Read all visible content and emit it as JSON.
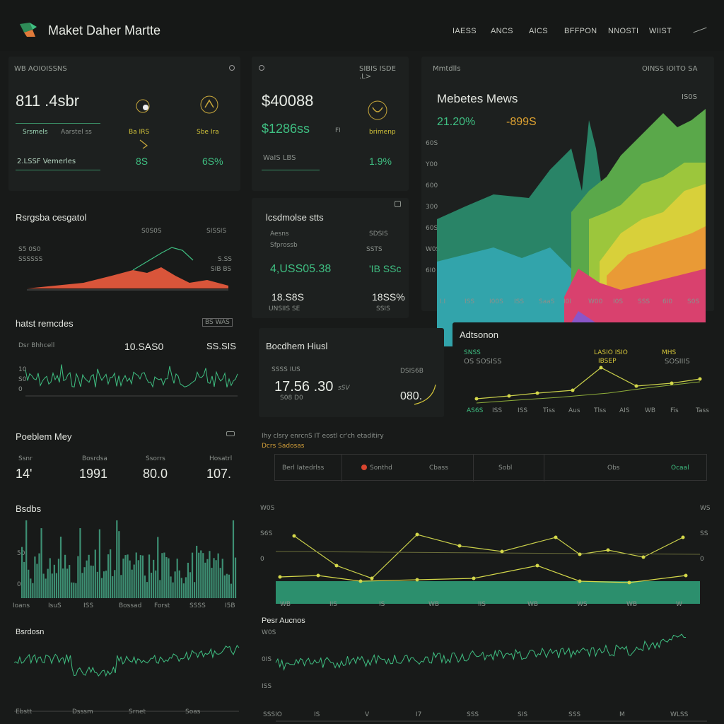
{
  "header": {
    "title": "Maket Daher Martte",
    "nav": [
      "IAESS",
      "ANCS",
      "AICS",
      "BFFPON",
      "NNOSTI",
      "WIIST"
    ],
    "logo_colors": [
      "#2e8b57",
      "#e07a3a",
      "#3fbf82"
    ]
  },
  "panel1": {
    "title": "WB AOIOISSNS",
    "big_value": "811 .4sbr",
    "sub_left": "Srsmels",
    "sub_right": "Aarstel ss",
    "bottom_left": "2.LSSF Vemerles",
    "col2_label": "Ba IRS",
    "col2_value": "8S",
    "col3_label": "Sbe Ira",
    "col3_value": "6S%"
  },
  "panel2": {
    "title": "SIBIS ISDE .L>",
    "big_value": "$40088",
    "green_value": "$1286ss",
    "green_suffix": "FI",
    "label_a": "WaIS LBS",
    "label_b": "brimenp",
    "pct": "1.9%"
  },
  "panel3": {
    "title": "Mmtdlls",
    "right_label": "OINSS IOITO SA",
    "heading": "Mebetes Mews",
    "tag": "IS0S",
    "green_pct": "21.20%",
    "orange_pct": "-899S",
    "y_ticks": [
      "60S",
      "Y00",
      "600",
      "300",
      "60S",
      "W0S",
      "6I0"
    ],
    "x_ticks": [
      "I.I",
      "ISS",
      "I00S",
      "ISS",
      "SaaS",
      "I0I",
      "W00",
      "I0S",
      "SSS",
      "6I0",
      "S0S"
    ]
  },
  "panel4": {
    "title": "Rsrgsba cesgatol",
    "tick_a": "S0S0S",
    "tick_b": "SISSIS",
    "y_a": "S5 0S0",
    "y_b": "SSSSSS",
    "legend": "S.SS",
    "legend2": "SIB BS"
  },
  "panel5": {
    "title": "lcsdmolse stts",
    "label_a": "Aesns",
    "label_b": "Sfprossb",
    "label_c": "SDSIS",
    "label_d": "SSTS",
    "green_value": "4,USS05.38",
    "green_value_b": "'IB SSc",
    "val_a": "18.S8S",
    "val_b": "18SS%",
    "sub_a": "UNSIIS SE",
    "sub_b": "SSIS"
  },
  "panel6": {
    "title": "hatst remcdes",
    "corner": "BS WAS",
    "label": "Dsr Bhhcell",
    "value_a": "10.SAS0",
    "value_b": "SS.SIS",
    "y_ticks": [
      "10",
      "S0",
      "0"
    ]
  },
  "panel7": {
    "title": "Bocdhem Hiusl",
    "label_a": "SSSS IUS",
    "label_b": "DSIS6B",
    "value": "17.56 .30",
    "value_suffix": "sSV",
    "sub": "S08 D0",
    "right_value": "080."
  },
  "panel8": {
    "title": "Adtsonon",
    "legend_a": "SNSS",
    "legend_b": "OS SOSISS",
    "legend_c": "LASIO ISIO",
    "legend_d": "IBSEP",
    "legend_e": "MHS",
    "legend_f": "SOSIIIS",
    "x_ticks": [
      "AS6S",
      "ISS",
      "ISS",
      "Tiss",
      "Aus",
      "Tlss",
      "AIS",
      "WB",
      "Fis",
      "Tass"
    ]
  },
  "panel9": {
    "title": "Poeblem Mey",
    "cols": [
      {
        "label": "Ssnr",
        "value": "14'"
      },
      {
        "label": "Bosrdsa",
        "value": "1991"
      },
      {
        "label": "Ssorrs",
        "value": "80.0"
      },
      {
        "label": "Hosatrl",
        "value": "107."
      }
    ]
  },
  "table": {
    "title": "Ihy clsry enrcnS IT eostl cr'ch etaditiry",
    "subtitle": "Dcrs Sadosas",
    "cells": [
      "Berl Iatedrlss",
      "Sonthd",
      "Cbass",
      "Sobl",
      "Obs",
      "Ocaal"
    ],
    "dot_color": "#d8452f"
  },
  "panel10": {
    "title": "Bsdbs",
    "x_ticks": [
      "Ioans",
      "IsuS",
      "ISS",
      "Bossad",
      "Forst",
      "SSSS",
      "I5B"
    ],
    "y_ticks": [
      "50",
      "0"
    ]
  },
  "panel11": {
    "y_ticks_left": [
      "W0S",
      "S6S",
      "0"
    ],
    "y_ticks_right": [
      "WS",
      "SS",
      "0"
    ],
    "x_ticks": [
      "WB",
      "IIS",
      "IS",
      "WB",
      "IIS",
      "WB",
      "WS",
      "WB",
      "W"
    ]
  },
  "panel12": {
    "title": "Bsrdosn",
    "x_ticks": [
      "Ebstt",
      "Dsssm",
      "Srnet",
      "Soas"
    ]
  },
  "panel13": {
    "title": "Pesr Aucnos",
    "y_ticks": [
      "W0S",
      "0IS",
      "ISS"
    ],
    "x_ticks": [
      "SSSIO",
      "IS",
      "V",
      "I7",
      "SSS",
      "SIS",
      "SSS",
      "M",
      "WLSS"
    ]
  }
}
